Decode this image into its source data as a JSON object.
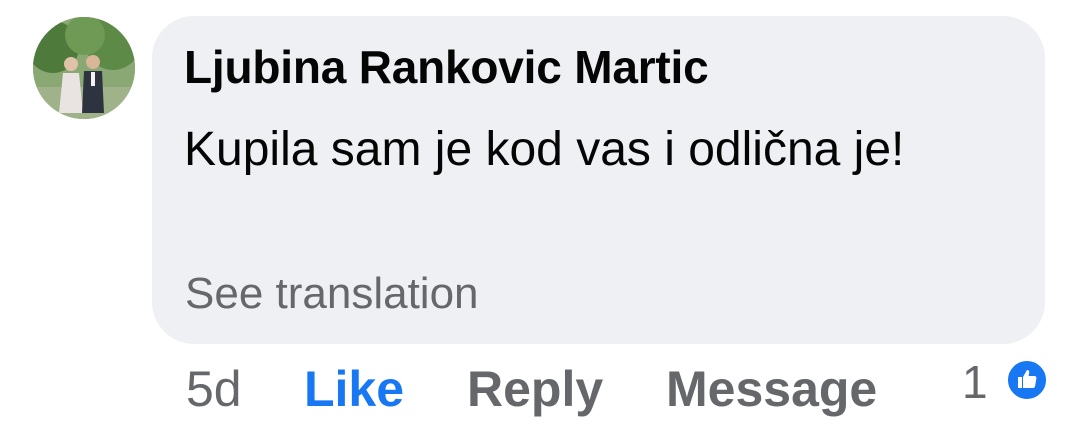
{
  "comment": {
    "author": "Ljubina Rankovic Martic",
    "text": "Kupila sam je kod vas i odlična je!",
    "see_translation": "See translation"
  },
  "actions": {
    "time": "5d",
    "like": "Like",
    "reply": "Reply",
    "message": "Message"
  },
  "reactions": {
    "count": "1",
    "icon": "thumbs-up-icon",
    "color": "#1877f2"
  },
  "colors": {
    "bubble": "#eff0f4",
    "link": "#1877f2",
    "secondary_text": "#65676b"
  }
}
